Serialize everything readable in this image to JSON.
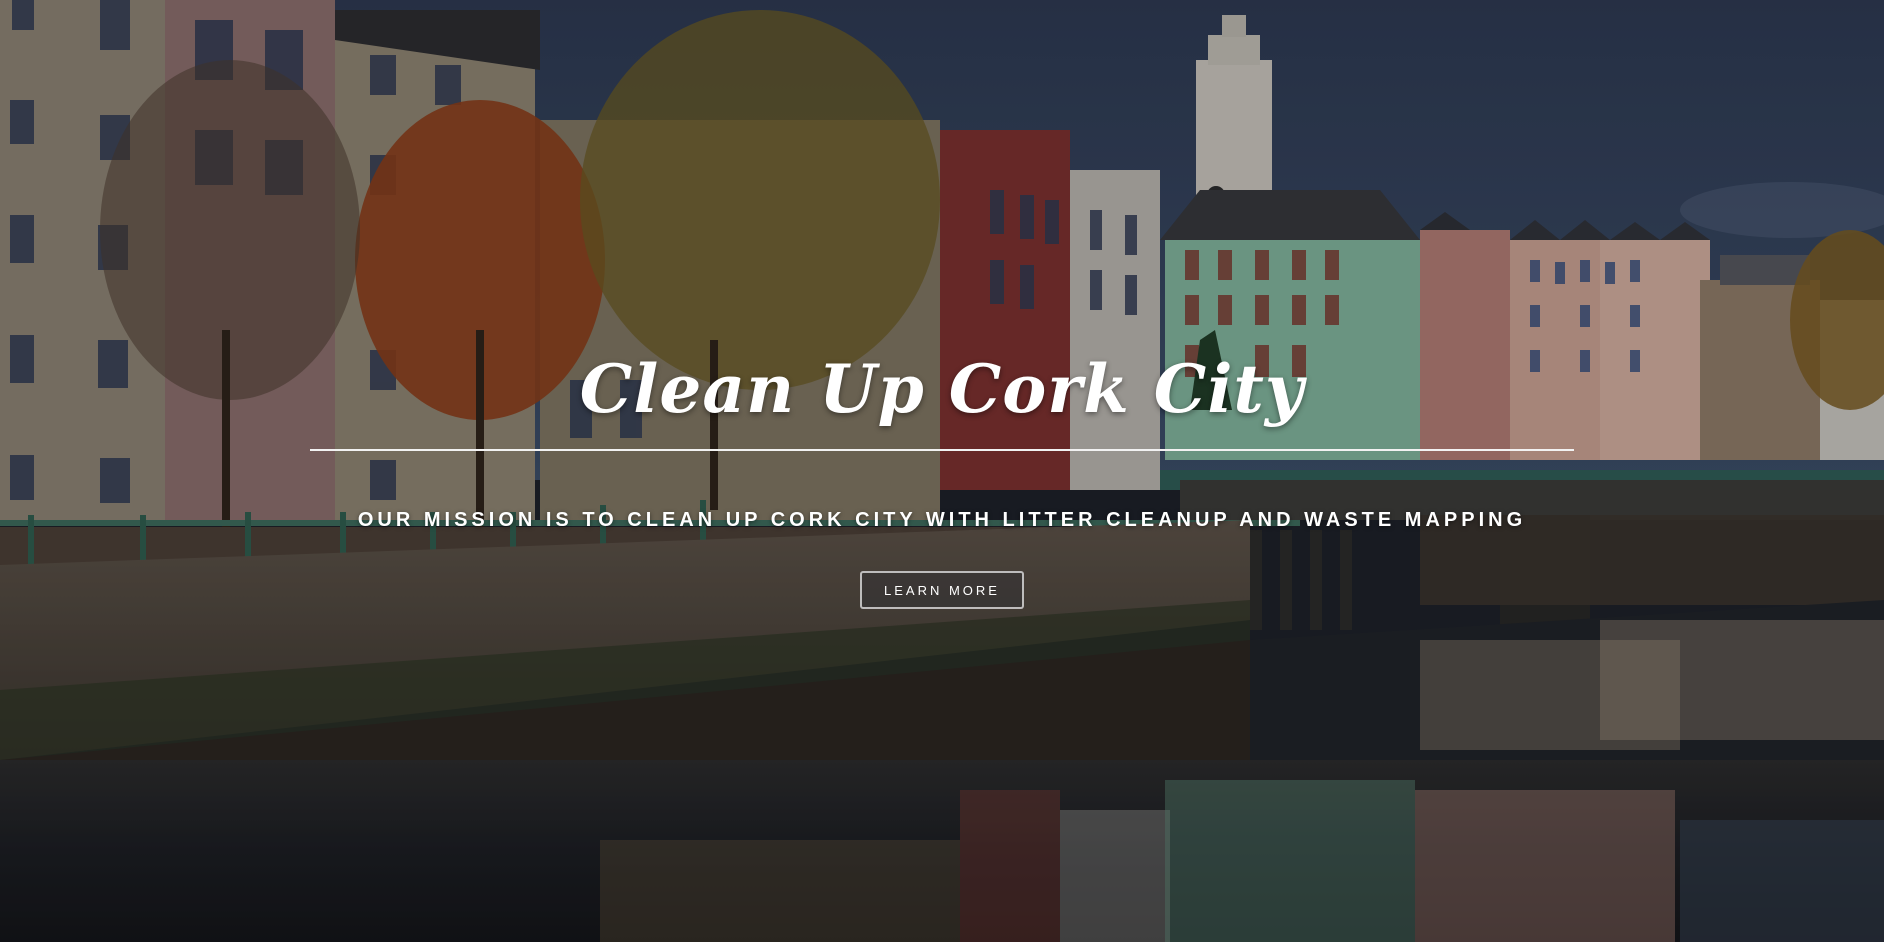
{
  "hero": {
    "title": "Clean Up Cork City",
    "mission": "OUR MISSION IS TO CLEAN UP CORK CITY WITH LITTER CLEANUP AND WASTE MAPPING",
    "cta_label": "LEARN MORE"
  },
  "colors": {
    "text": "#ffffff",
    "sky": "#2f3e57",
    "river": "#1a1d22"
  },
  "background": {
    "image": "river-quay-cityscape"
  }
}
